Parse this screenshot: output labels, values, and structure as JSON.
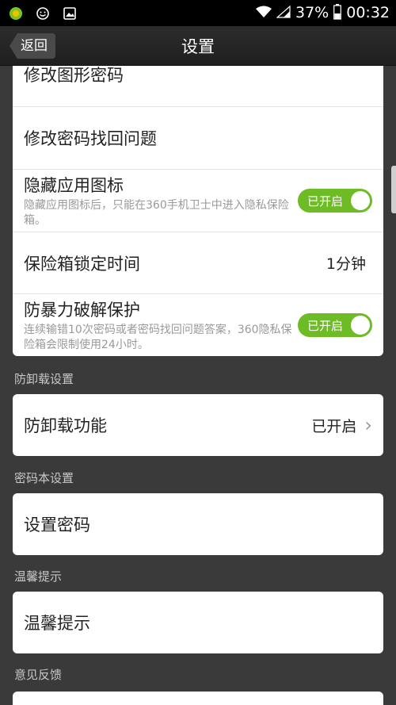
{
  "status_bar": {
    "battery": "37%",
    "time": "00:32",
    "icons": [
      "app-360-icon",
      "smiley-icon",
      "image-icon",
      "wifi-icon",
      "signal-icon",
      "battery-icon"
    ]
  },
  "header": {
    "back_label": "返回",
    "title": "设置"
  },
  "privacy_card": {
    "items": [
      {
        "title": "修改图形密码"
      },
      {
        "title": "修改密码找回问题"
      },
      {
        "title": "隐藏应用图标",
        "subtitle": "隐藏应用图标后，只能在360手机卫士中进入隐私保险箱。",
        "toggle": "已开启"
      },
      {
        "title": "保险箱锁定时间",
        "value": "1分钟"
      },
      {
        "title": "防暴力破解保护",
        "subtitle": "连续输错10次密码或者密码找回问题答案，360隐私保险箱会限制使用24小时。",
        "toggle": "已开启"
      }
    ]
  },
  "sections": {
    "uninstall": {
      "header": "防卸载设置",
      "item_title": "防卸载功能",
      "item_value": "已开启"
    },
    "password_book": {
      "header": "密码本设置",
      "item_title": "设置密码"
    },
    "tips": {
      "header": "温馨提示",
      "item_title": "温馨提示"
    },
    "feedback": {
      "header": "意见反馈"
    }
  },
  "colors": {
    "toggle_on": "#6dbb25",
    "background": "#3a3a3a",
    "card": "#ffffff"
  }
}
